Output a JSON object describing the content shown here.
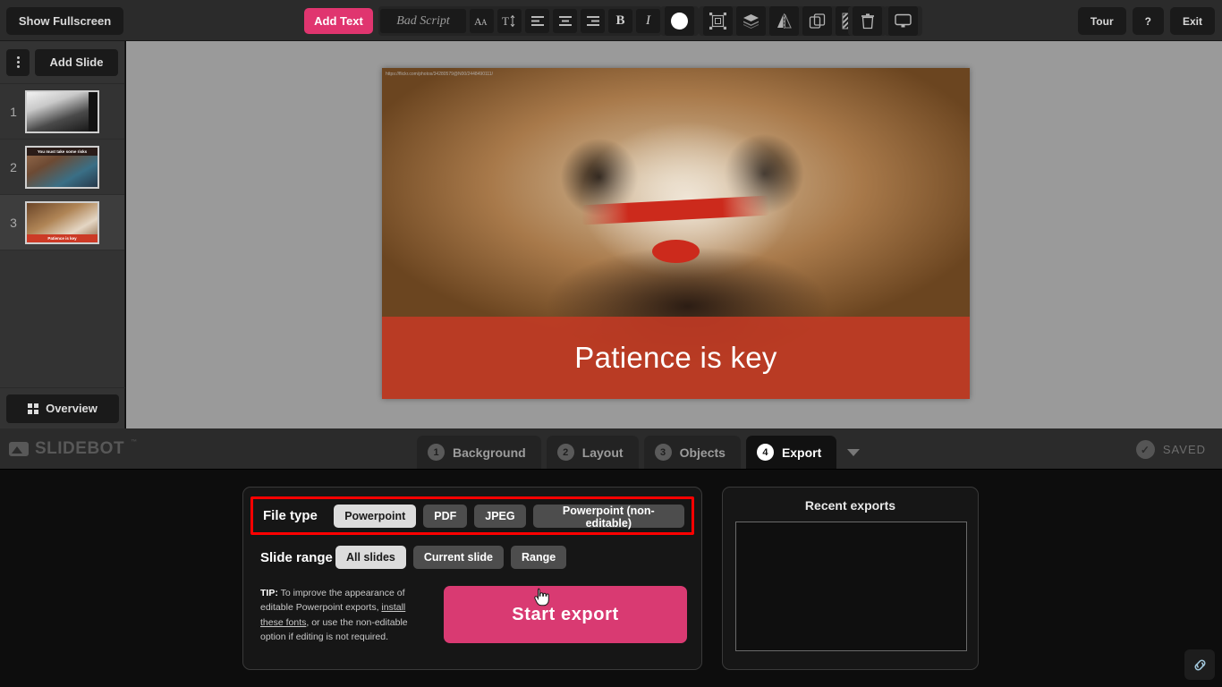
{
  "toolbar": {
    "show_fullscreen": "Show Fullscreen",
    "add_text": "Add Text",
    "font_name": "Bad Script",
    "tour": "Tour",
    "help": "?",
    "exit": "Exit",
    "icons": {
      "font_size": "font-size-icon",
      "line_height": "line-height-icon",
      "align_left": "align-left-icon",
      "align_center": "align-center-icon",
      "align_right": "align-right-icon",
      "bold": "B",
      "italic": "I",
      "color": "color-swatch-icon",
      "transform": "transform-icon",
      "layers": "layers-icon",
      "flip": "flip-icon",
      "duplicate": "duplicate-icon",
      "pattern": "pattern-icon",
      "delete": "trash-icon",
      "present": "monitor-icon"
    },
    "accent_pink": "#e0356f"
  },
  "sidebar": {
    "add_slide": "Add Slide",
    "menu_icon": "kebab-menu-icon",
    "overview": "Overview",
    "slides": [
      {
        "number": "1",
        "caption": ""
      },
      {
        "number": "2",
        "caption": "You must take some risks"
      },
      {
        "number": "3",
        "caption": "Patience is key"
      }
    ],
    "active_slide": "3"
  },
  "canvas": {
    "attribution": "https://flickr.com/photos/34280579@N00/2448490111/",
    "caption": "Patience is key",
    "band_color": "#c43a24"
  },
  "stepbar": {
    "logo": "SLIDEBOT",
    "logo_tm": "™",
    "tabs": [
      {
        "num": "1",
        "label": "Background",
        "active": false
      },
      {
        "num": "2",
        "label": "Layout",
        "active": false
      },
      {
        "num": "3",
        "label": "Objects",
        "active": false
      },
      {
        "num": "4",
        "label": "Export",
        "active": true
      }
    ],
    "saved": "SAVED",
    "saved_icon": "check-circle-icon"
  },
  "export": {
    "file_type_label": "File type",
    "file_types": [
      {
        "label": "Powerpoint",
        "selected": true
      },
      {
        "label": "PDF",
        "selected": false
      },
      {
        "label": "JPEG",
        "selected": false
      },
      {
        "label": "Powerpoint (non-editable)",
        "selected": false
      }
    ],
    "slide_range_label": "Slide range",
    "slide_ranges": [
      {
        "label": "All slides",
        "selected": true
      },
      {
        "label": "Current slide",
        "selected": false
      },
      {
        "label": "Range",
        "selected": false
      }
    ],
    "tip_prefix": "TIP:",
    "tip_part1": " To improve the appearance of editable Powerpoint exports, ",
    "tip_link": "install these fonts",
    "tip_part2": ", or use the non-editable option if editing is not required.",
    "start_export": "Start export",
    "start_export_color": "#d93a72",
    "highlight_color": "#ff0000"
  },
  "recent": {
    "title": "Recent exports",
    "items": []
  },
  "footer": {
    "link_icon": "link-chain-icon"
  }
}
